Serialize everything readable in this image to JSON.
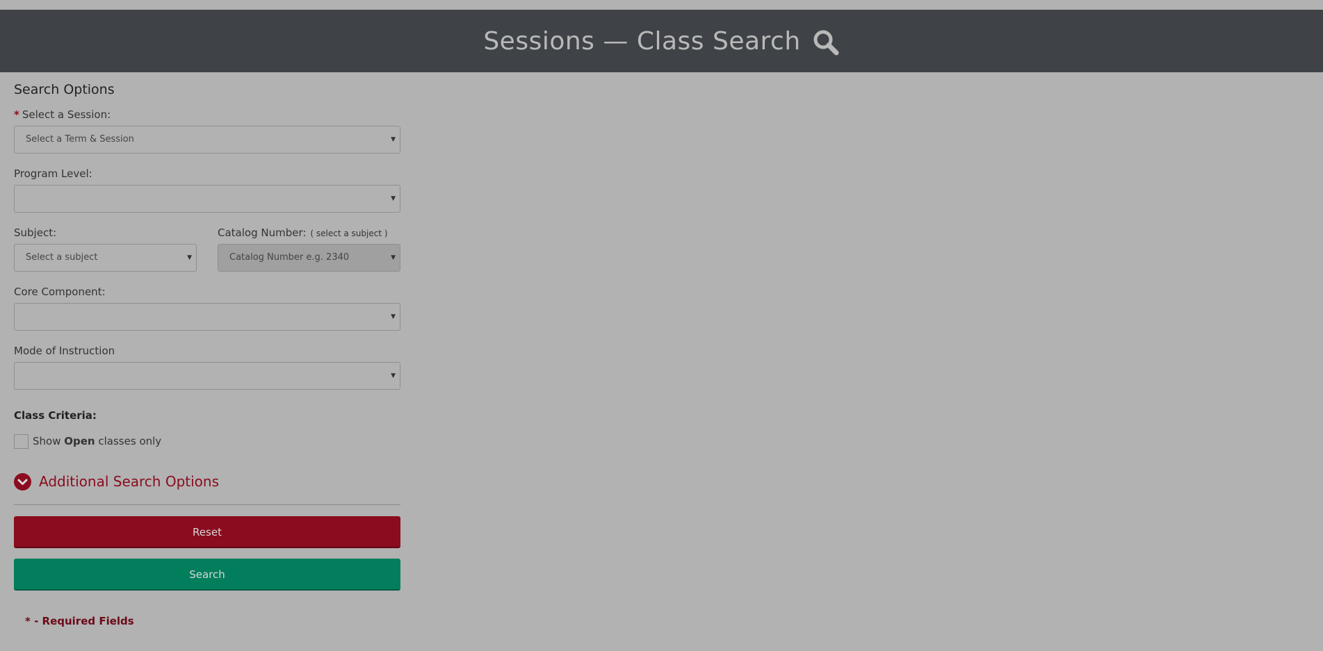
{
  "header": {
    "title": "Sessions — Class Search",
    "icon": "search-icon"
  },
  "panel": {
    "section_title": "Search Options",
    "session": {
      "required_marker": "*",
      "label": "Select a Session:",
      "value": "Select a Term & Session"
    },
    "program_level": {
      "label": "Program Level:",
      "value": ""
    },
    "subject": {
      "label": "Subject:",
      "value": "Select a subject"
    },
    "catalog_number": {
      "label": "Catalog Number:",
      "hint": "( select a subject )",
      "value": "Catalog Number e.g. 2340"
    },
    "core_component": {
      "label": "Core Component:",
      "value": ""
    },
    "mode_of_instruction": {
      "label": "Mode of Instruction",
      "value": ""
    },
    "class_criteria": {
      "label": "Class Criteria:",
      "open_only_prefix": "Show",
      "open_only_bold": "Open",
      "open_only_suffix": "classes only",
      "checked": false
    },
    "additional_options": {
      "label": "Additional Search Options",
      "icon": "chevron-down-circle-icon"
    },
    "buttons": {
      "reset": "Reset",
      "search": "Search"
    },
    "required_note": "* - Required Fields"
  },
  "colors": {
    "header_bg": "#3f4347",
    "page_bg": "#b2b2b2",
    "accent_red": "#8a0c1e",
    "accent_green": "#027e5c"
  }
}
